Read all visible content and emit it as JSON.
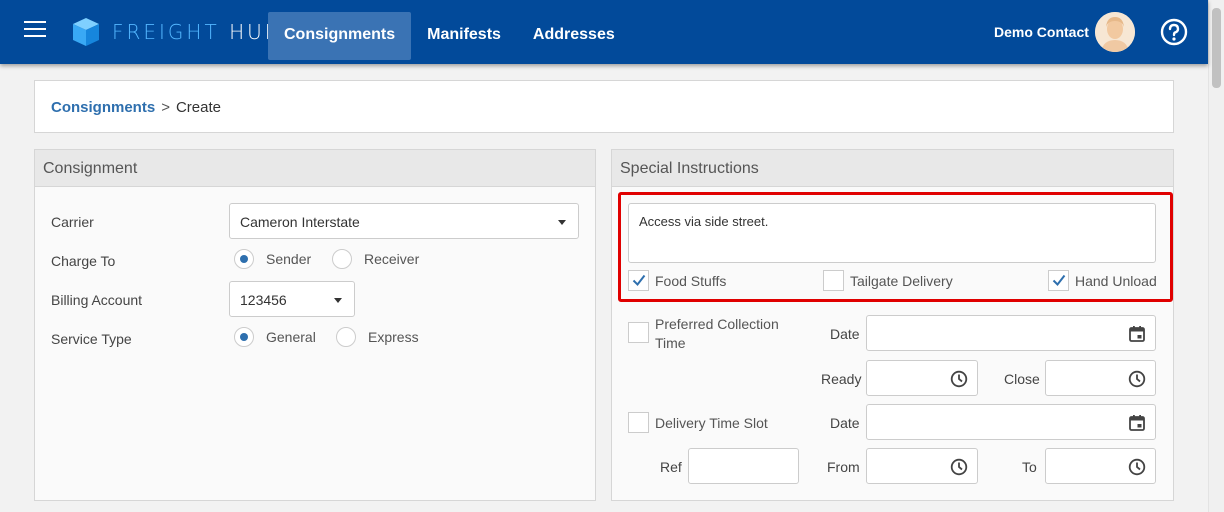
{
  "header": {
    "logo": {
      "word1": "FREIGHT",
      "word2": "HUB"
    },
    "nav": [
      {
        "label": "Consignments",
        "active": true
      },
      {
        "label": "Manifests",
        "active": false
      },
      {
        "label": "Addresses",
        "active": false
      }
    ],
    "user_name": "Demo Contact",
    "colors": {
      "bar": "#024a9a",
      "active_tab": "#3a73b4"
    }
  },
  "breadcrumb": {
    "parent": "Consignments",
    "separator": ">",
    "current": "Create"
  },
  "consignment": {
    "title": "Consignment",
    "carrier": {
      "label": "Carrier",
      "value": "Cameron Interstate"
    },
    "charge_to": {
      "label": "Charge To",
      "options": [
        "Sender",
        "Receiver"
      ],
      "selected": "Sender"
    },
    "billing_account": {
      "label": "Billing Account",
      "value": "123456"
    },
    "service_type": {
      "label": "Service Type",
      "options": [
        "General",
        "Express"
      ],
      "selected": "General"
    }
  },
  "special": {
    "title": "Special Instructions",
    "instructions": "Access via side street.",
    "checkboxes": [
      {
        "label": "Food Stuffs",
        "checked": true
      },
      {
        "label": "Tailgate Delivery",
        "checked": false
      },
      {
        "label": "Hand Unload",
        "checked": true
      }
    ],
    "collection": {
      "label_line1": "Preferred Collection",
      "label_line2": "Time",
      "checked": false,
      "date_label": "Date",
      "ready_label": "Ready",
      "close_label": "Close"
    },
    "delivery": {
      "label": "Delivery Time Slot",
      "checked": false,
      "date_label": "Date",
      "ref_label": "Ref",
      "from_label": "From",
      "to_label": "To"
    },
    "highlight_color": "#e00000"
  }
}
